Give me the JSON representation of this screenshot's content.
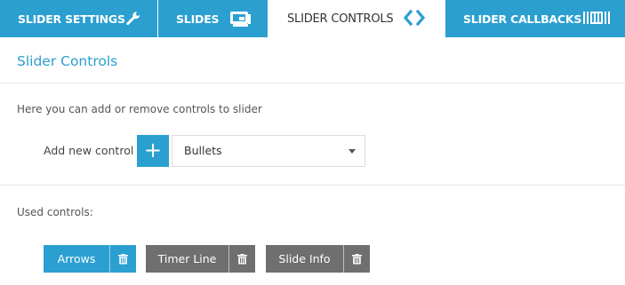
{
  "tabs": [
    {
      "label": "SLIDER SETTINGS",
      "icon": "wrench-icon",
      "active": false
    },
    {
      "label": "SLIDES",
      "icon": "slides-icon",
      "active": false
    },
    {
      "label": "SLIDER CONTROLS",
      "icon": "code-arrows-icon",
      "active": true
    },
    {
      "label": "SLIDER CALLBACKS",
      "icon": "barcode-icon",
      "active": false
    }
  ],
  "section": {
    "title": "Slider Controls",
    "description": "Here you can add or remove controls to slider"
  },
  "add_control": {
    "label": "Add new control",
    "button_label": "+",
    "selected": "Bullets"
  },
  "used_controls": {
    "label": "Used controls:",
    "items": [
      {
        "name": "Arrows",
        "style": "blue"
      },
      {
        "name": "Timer Line",
        "style": "gray"
      },
      {
        "name": "Slide Info",
        "style": "gray"
      }
    ]
  },
  "colors": {
    "accent": "#2b9fd0",
    "control_gray": "#6f6f6f",
    "divider": "#e6e6e6"
  }
}
